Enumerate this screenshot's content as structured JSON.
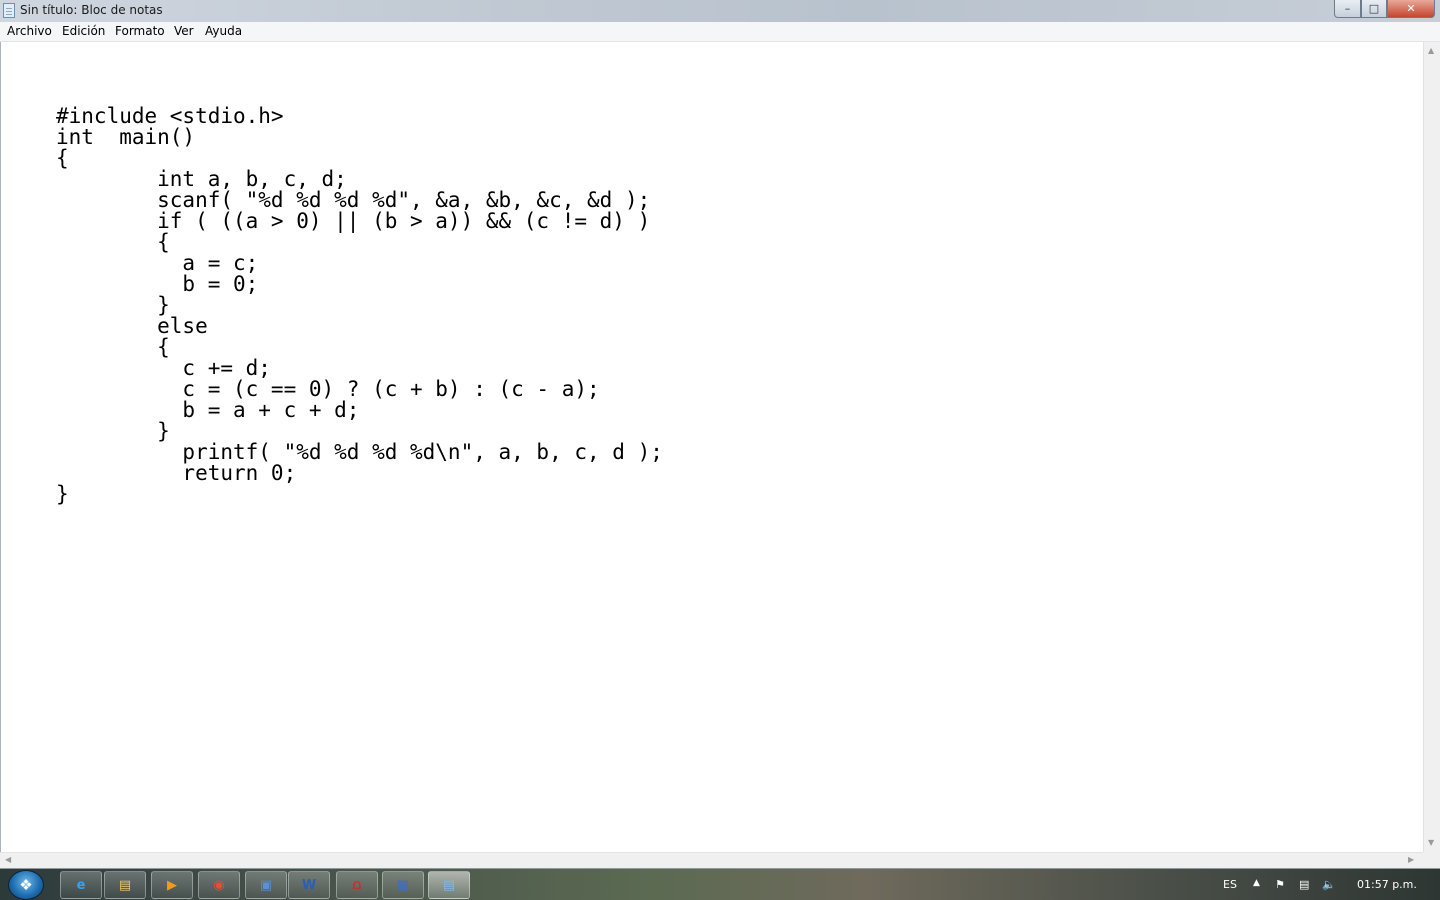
{
  "window": {
    "title": "Sin título: Bloc de notas"
  },
  "controls": {
    "minimize": "–",
    "maximize": "□",
    "close": "✕"
  },
  "menu": {
    "items": [
      {
        "label": "Archivo"
      },
      {
        "label": "Edición"
      },
      {
        "label": "Formato"
      },
      {
        "label": "Ver"
      },
      {
        "label": "Ayuda"
      }
    ]
  },
  "editor": {
    "content": "#include <stdio.h>\nint  main()\n{\n        int a, b, c, d;\n        scanf( \"%d %d %d %d\", &a, &b, &c, &d );\n        if ( ((a > 0) || (b > a)) && (c != d) )\n        {\n          a = c;\n          b = 0;\n        }\n        else\n        {\n          c += d;\n          c = (c == 0) ? (c + b) : (c - a);\n          b = a + c + d;\n        }\n          printf( \"%d %d %d %d\\n\", a, b, c, d );\n          return 0;\n}"
  },
  "taskbar": {
    "start_icon": "windows-logo",
    "pinned": [
      {
        "name": "internet-explorer-icon",
        "glyph": "e",
        "color": "#3aa0f0"
      },
      {
        "name": "folder-icon",
        "glyph": "▤",
        "color": "#e8c56a"
      },
      {
        "name": "media-player-icon",
        "glyph": "▶",
        "color": "#f39a1d"
      },
      {
        "name": "chrome-icon",
        "glyph": "◉",
        "color": "#e94b35"
      },
      {
        "name": "network-app-icon",
        "glyph": "▣",
        "color": "#5b8fd6"
      },
      {
        "name": "word-icon",
        "glyph": "W",
        "color": "#2b5fb5"
      },
      {
        "name": "acrobat-icon",
        "glyph": "⩍",
        "color": "#d8261c"
      },
      {
        "name": "app-icon",
        "glyph": "▦",
        "color": "#3e6fb8"
      },
      {
        "name": "notepad-icon",
        "glyph": "▤",
        "color": "#7fb7e6"
      }
    ],
    "tray": {
      "language": "ES",
      "clock": "01:57 p.m."
    }
  }
}
